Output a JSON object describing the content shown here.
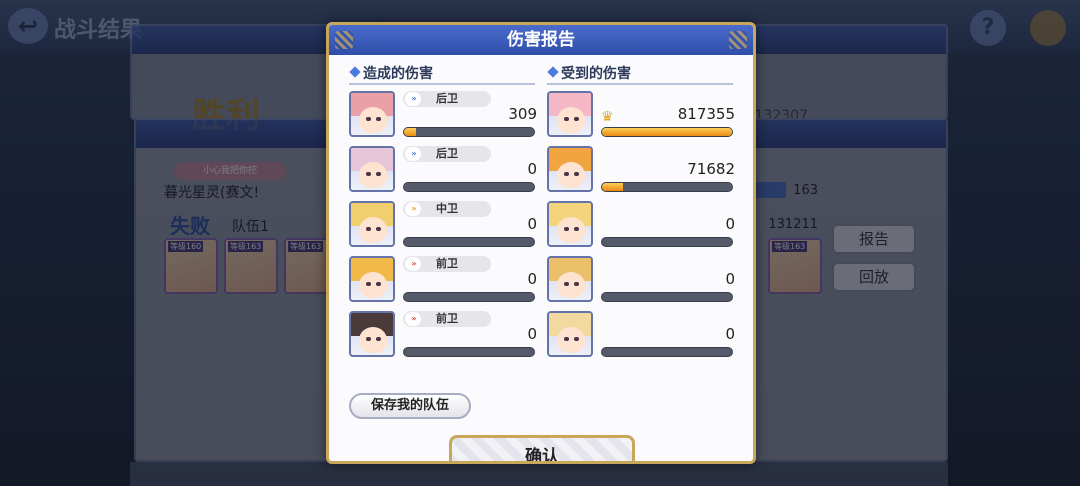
{
  "background": {
    "title": "战斗结果",
    "victory_text": "胜利",
    "defeat_text": "失败",
    "top_value": "132307",
    "tag_text": "小心我把你挖",
    "player_name": "暮光星灵(赛文!",
    "team_label": "队伍1",
    "score_a": "163",
    "score_b": "131211",
    "report_button": "报告",
    "replay_button": "回放",
    "thumb_levels": [
      "等级160",
      "等级163",
      "等级163"
    ],
    "thumb_level_right": "等级163"
  },
  "modal": {
    "title": "伤害报告",
    "dealt_title": "造成的伤害",
    "received_title": "受到的伤害",
    "dealt": [
      {
        "position": "后卫",
        "position_type": "back",
        "value": "309",
        "fill": 0.09,
        "hair": "#e9a0a6"
      },
      {
        "position": "后卫",
        "position_type": "back",
        "value": "0",
        "fill": 0,
        "hair": "#e7c6d9"
      },
      {
        "position": "中卫",
        "position_type": "mid",
        "value": "0",
        "fill": 0,
        "hair": "#f2cf6e"
      },
      {
        "position": "前卫",
        "position_type": "front",
        "value": "0",
        "fill": 0,
        "hair": "#f0b94a"
      },
      {
        "position": "前卫",
        "position_type": "front",
        "value": "0",
        "fill": 0,
        "hair": "#4a3a3a"
      }
    ],
    "received": [
      {
        "value": "817355",
        "fill": 1.0,
        "crown": true,
        "hair": "#f6b7c6"
      },
      {
        "value": "71682",
        "fill": 0.16,
        "crown": false,
        "hair": "#f0a540"
      },
      {
        "value": "0",
        "fill": 0,
        "crown": false,
        "hair": "#f4d57e"
      },
      {
        "value": "0",
        "fill": 0,
        "crown": false,
        "hair": "#ecc06a"
      },
      {
        "value": "0",
        "fill": 0,
        "crown": false,
        "hair": "#f2d9a0"
      }
    ],
    "save_team_button": "保存我的队伍",
    "confirm_button": "确认",
    "crown_icon": "crown-icon",
    "chevron_icon": "chevron-right-icon"
  }
}
